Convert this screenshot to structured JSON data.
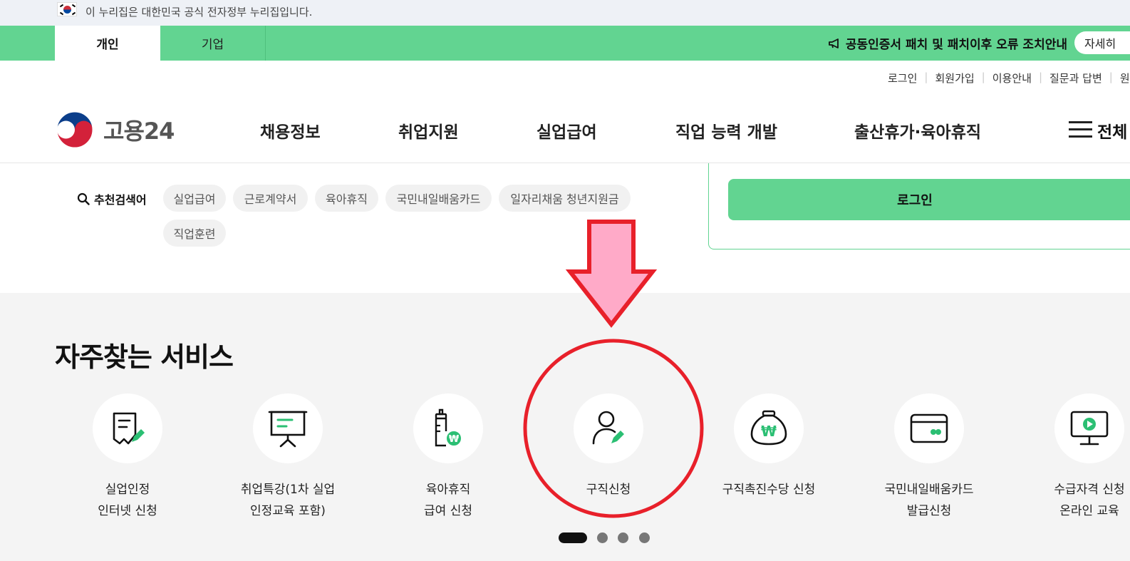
{
  "gov_bar": {
    "text": "이 누리집은 대한민국 공식 전자정부 누리집입니다."
  },
  "tabs": [
    {
      "label": "개인",
      "active": true
    },
    {
      "label": "기업",
      "active": false
    }
  ],
  "notice": {
    "text": "공동인증서 패치 및 패치이후 오류 조치안내",
    "button": "자세히"
  },
  "util_links": [
    "로그인",
    "회원가입",
    "이용안내",
    "질문과 답변",
    "원"
  ],
  "logo": {
    "text": "고용24"
  },
  "gnb": [
    "채용정보",
    "취업지원",
    "실업급여",
    "직업 능력 개발",
    "출산휴가·육아휴직"
  ],
  "all_menu": "전체",
  "search": {
    "label": "추천검색어",
    "keywords": [
      "실업급여",
      "근로계약서",
      "육아휴직",
      "국민내일배움카드",
      "일자리채움 청년지원금",
      "직업훈련"
    ]
  },
  "login": {
    "button": "로그인"
  },
  "services": {
    "title": "자주찾는 서비스",
    "items": [
      {
        "line1": "실업인정",
        "line2": "인터넷 신청",
        "icon": "document-pen-icon"
      },
      {
        "line1": "취업특강(1차 실업",
        "line2": "인정교육 포함)",
        "icon": "presentation-board-icon"
      },
      {
        "line1": "육아휴직",
        "line2": "급여 신청",
        "icon": "baby-bottle-won-icon"
      },
      {
        "line1": "구직신청",
        "line2": "",
        "icon": "person-pen-icon"
      },
      {
        "line1": "구직촉진수당 신청",
        "line2": "",
        "icon": "money-bag-won-icon"
      },
      {
        "line1": "국민내일배움카드",
        "line2": "발급신청",
        "icon": "card-icon"
      },
      {
        "line1": "수급자격 신청",
        "line2": "온라인 교육",
        "icon": "monitor-play-icon"
      }
    ]
  },
  "pagination": {
    "pages": 4,
    "active_page": 1
  },
  "colors": {
    "brand_green": "#62d491",
    "icon_green": "#2bbf73",
    "annotation_red": "#e8202a",
    "annotation_pink": "#ffaac8"
  }
}
